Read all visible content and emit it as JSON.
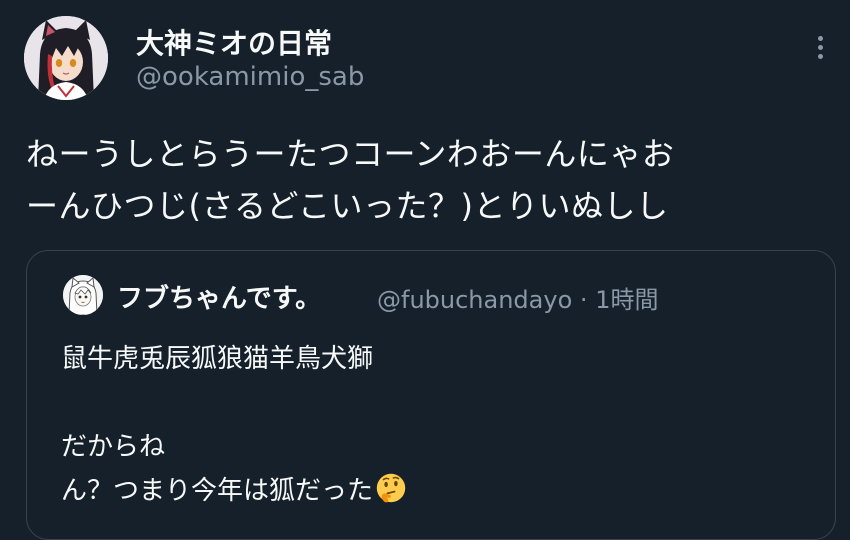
{
  "tweet": {
    "display_name": "大神ミオの日常",
    "handle": "@ookamimio_sab",
    "text_lines": [
      "ねーうしとらうーたつコーンわおーんにゃお",
      "ーんひつじ(さるどこいった？)とりいぬしし"
    ]
  },
  "quote": {
    "display_name": "フブちゃんです。",
    "handle": "@fubuchandayo",
    "separator": "·",
    "time": "1時間",
    "text_lines": [
      "鼠牛虎兎辰狐狼猫羊鳥犬獅",
      "",
      "だからね",
      "ん？つまり今年は狐だった"
    ],
    "trailing_emoji": "thinking-face-icon"
  },
  "colors": {
    "background": "#15202b",
    "text_primary": "#f7f9f9",
    "text_secondary": "#8b98a5",
    "border": "#38444d"
  }
}
